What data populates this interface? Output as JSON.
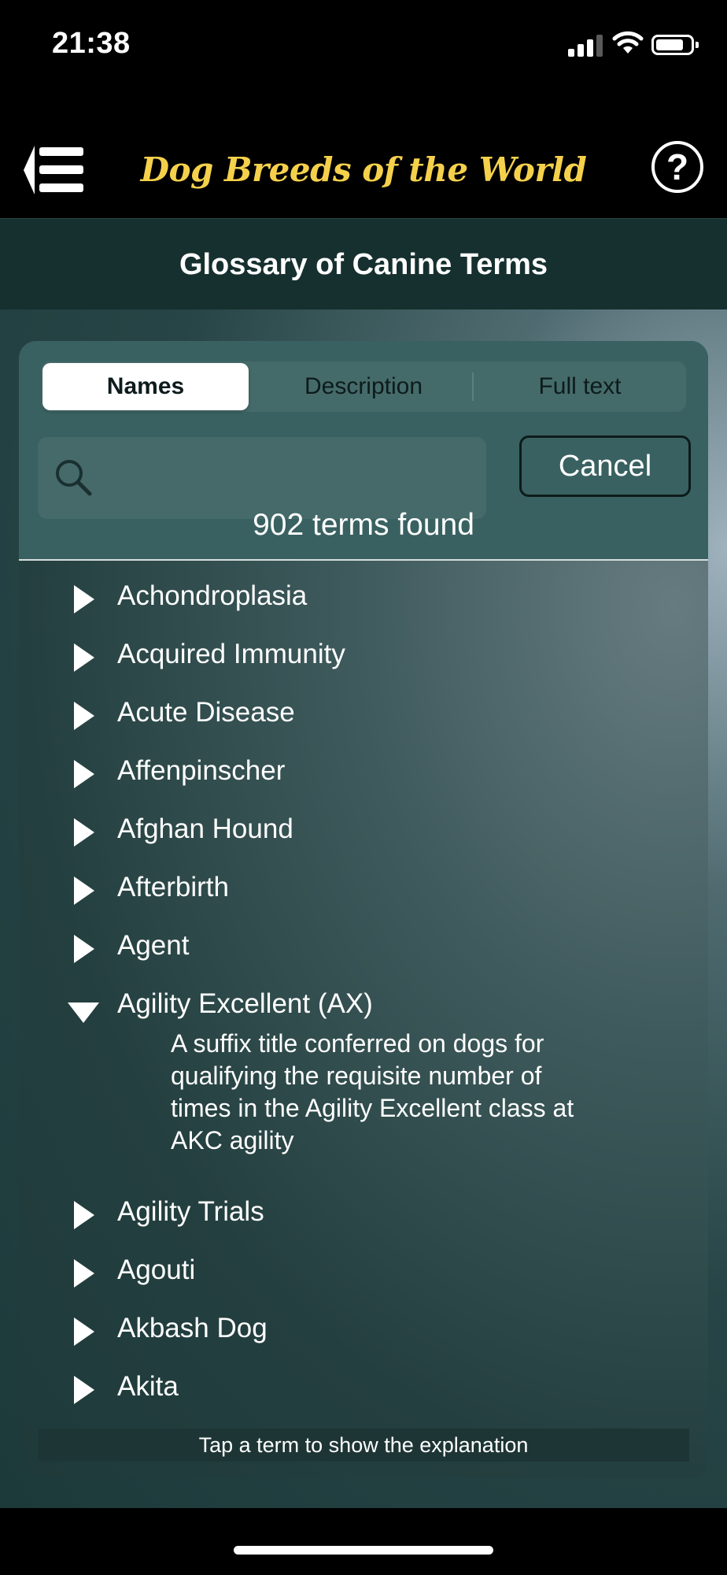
{
  "status": {
    "time": "21:38"
  },
  "nav": {
    "title": "Dog Breeds of the World",
    "help": "?"
  },
  "header": {
    "title": "Glossary of Canine Terms"
  },
  "segments": [
    "Names",
    "Description",
    "Full text"
  ],
  "search": {
    "placeholder": "",
    "cancel": "Cancel",
    "count": "902 terms found"
  },
  "terms": [
    {
      "label": "Achondroplasia",
      "expanded": false
    },
    {
      "label": "Acquired Immunity",
      "expanded": false
    },
    {
      "label": "Acute Disease",
      "expanded": false
    },
    {
      "label": "Affenpinscher",
      "expanded": false
    },
    {
      "label": "Afghan Hound",
      "expanded": false
    },
    {
      "label": "Afterbirth",
      "expanded": false
    },
    {
      "label": "Agent",
      "expanded": false
    },
    {
      "label": "Agility Excellent (AX)",
      "expanded": true,
      "description": "A suffix title conferred on dogs for qualifying the requisite number of times in the Agility Excellent class at AKC agility"
    },
    {
      "label": "Agility Trials",
      "expanded": false
    },
    {
      "label": "Agouti",
      "expanded": false
    },
    {
      "label": "Akbash Dog",
      "expanded": false
    },
    {
      "label": "Akita",
      "expanded": false
    }
  ],
  "hint": "Tap a term to show the explanation"
}
